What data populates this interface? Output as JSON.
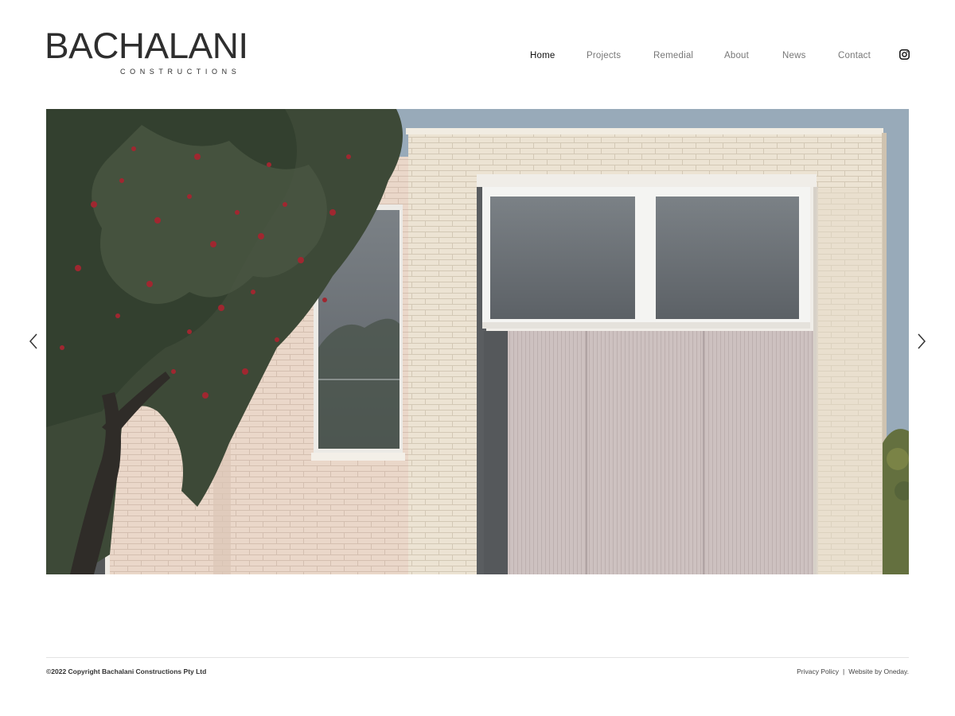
{
  "brand": {
    "name": "BACHALANI",
    "tagline": "CONSTRUCTIONS"
  },
  "nav": {
    "items": [
      {
        "label": "Home",
        "active": true
      },
      {
        "label": "Projects",
        "active": false
      },
      {
        "label": "Remedial",
        "active": false
      },
      {
        "label": "About",
        "active": false
      },
      {
        "label": "News",
        "active": false
      },
      {
        "label": "Contact",
        "active": false
      }
    ],
    "social_icon": "instagram-icon"
  },
  "hero": {
    "prev_icon": "chevron-left-icon",
    "next_icon": "chevron-right-icon"
  },
  "footer": {
    "copyright": "©2022 Copyright Bachalani Constructions Pty Ltd",
    "privacy": "Privacy Policy",
    "separator": "|",
    "credit": "Website by Oneday."
  },
  "colors": {
    "text_dark": "#111111",
    "nav_muted": "#777777",
    "sky": "#97a9b8",
    "brick": "#eadfcc",
    "cladding": "#c9bdbc",
    "window_frame": "#f2f2f0",
    "glass": "#6f7478",
    "foliage": "#3f4a3c",
    "flower": "#a3252c"
  }
}
